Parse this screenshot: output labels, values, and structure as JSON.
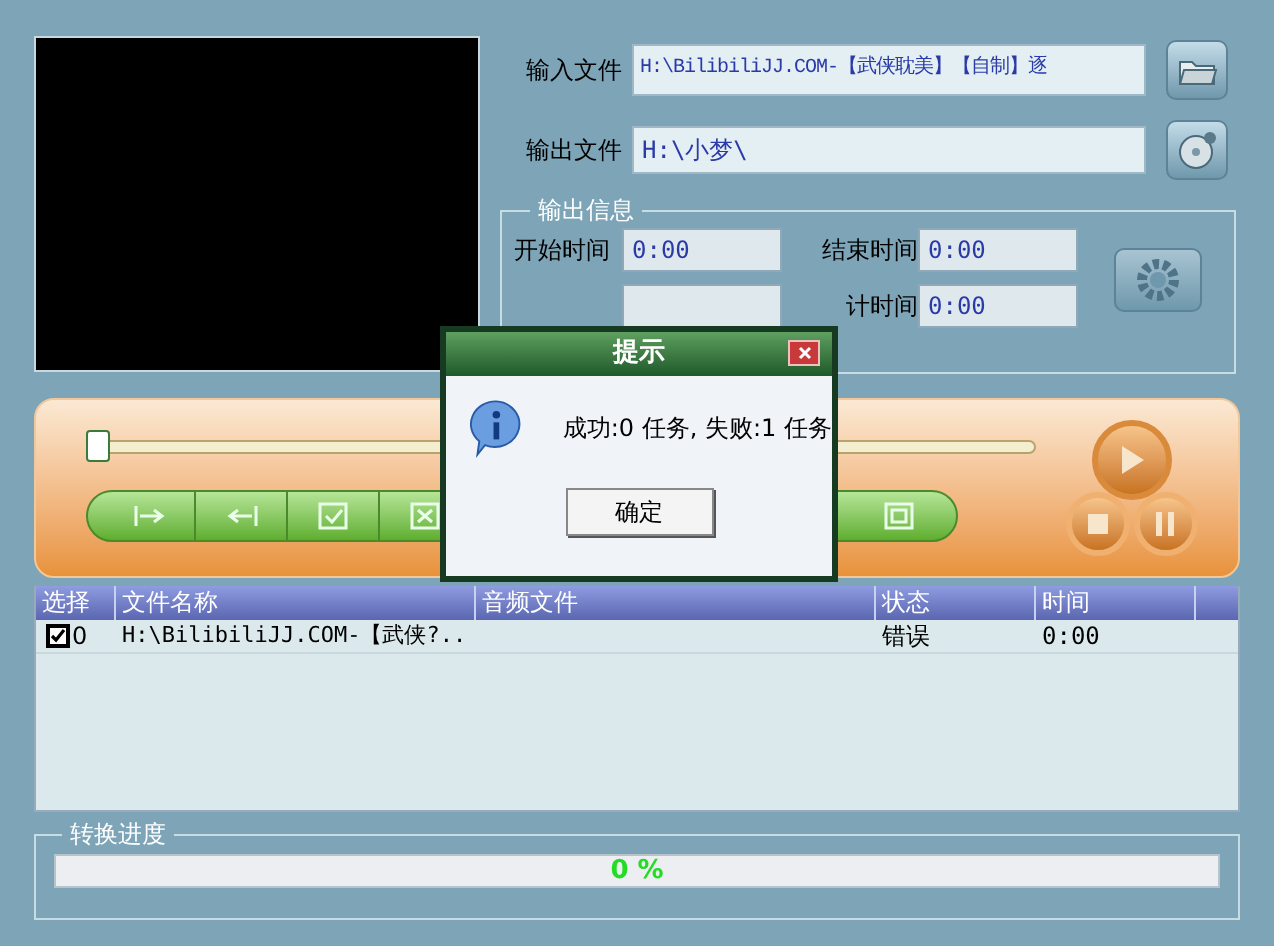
{
  "input_file": {
    "label": "输入文件",
    "value": "H:\\BilibiliJJ.COM-【武侠耽美】【自制】逐"
  },
  "output_file": {
    "label": "输出文件",
    "value": "H:\\小梦\\"
  },
  "output_info": {
    "title": "输出信息",
    "fields": [
      {
        "label": "开始时间",
        "value": "0:00"
      },
      {
        "label": "结束时间",
        "value": "0:00"
      },
      {
        "label": "计时间",
        "value": "0:00"
      }
    ]
  },
  "timeline": {
    "level": 0.0
  },
  "table": {
    "columns": [
      "选择",
      "文件名称",
      "音频文件",
      "状态",
      "时间"
    ],
    "rows": [
      {
        "checked": true,
        "index": "0",
        "file": "H:\\BilibiliJJ.COM-【武侠?..",
        "audio": "",
        "status": "错误",
        "time": "0:00"
      }
    ]
  },
  "progress": {
    "title": "转换进度",
    "level": 0.0,
    "reading": "0 %"
  },
  "dialog": {
    "title": "提示",
    "message": "成功:0 任务, 失败:1 任务",
    "button": "确定"
  }
}
